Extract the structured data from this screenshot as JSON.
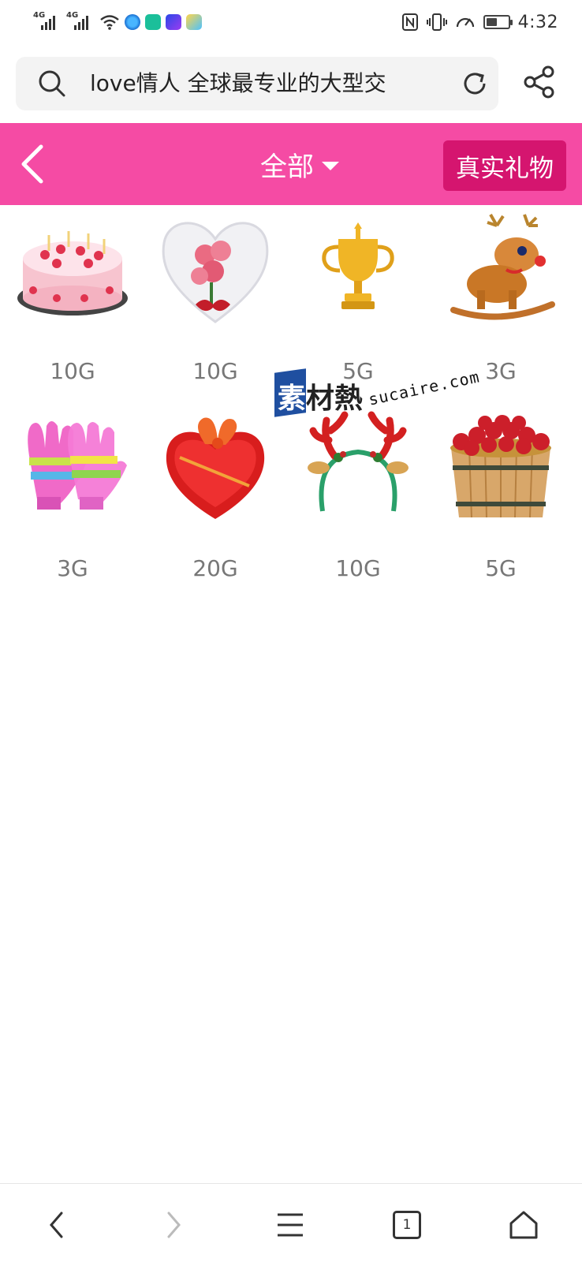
{
  "status_bar": {
    "network_1": "4G",
    "network_2": "4G",
    "time": "4:32",
    "battery_percent": 50,
    "icons": [
      "signal-icon",
      "signal-icon",
      "wifi-icon",
      "browser-app-icon",
      "green-app-icon",
      "video-app-icon",
      "send-app-icon",
      "nfc-icon",
      "vibrate-icon",
      "data-saver-icon",
      "battery-icon"
    ]
  },
  "address_bar": {
    "url_text": "love情人 全球最专业的大型交",
    "icons": [
      "search-icon",
      "reload-icon",
      "share-icon"
    ]
  },
  "header": {
    "filter_label": "全部",
    "real_gift_label": "真实礼物",
    "background_color": "#f54ba4",
    "button_color": "#d5156f",
    "icons": [
      "back-icon",
      "caret-down-icon"
    ]
  },
  "gifts": [
    {
      "name": "cake",
      "price": "10G"
    },
    {
      "name": "heart-roses",
      "price": "10G"
    },
    {
      "name": "trophy",
      "price": "5G"
    },
    {
      "name": "reindeer",
      "price": "3G"
    },
    {
      "name": "gloves",
      "price": "3G"
    },
    {
      "name": "heart-gift-box",
      "price": "20G"
    },
    {
      "name": "antler-headband",
      "price": "10G"
    },
    {
      "name": "apple-basket",
      "price": "5G"
    }
  ],
  "watermark": {
    "chars": "素材熱",
    "site": "sucaire.com"
  },
  "bottom_nav": {
    "tab_count": "1",
    "icons": [
      "nav-back-icon",
      "nav-forward-icon",
      "menu-icon",
      "tabs-icon",
      "home-icon"
    ]
  }
}
